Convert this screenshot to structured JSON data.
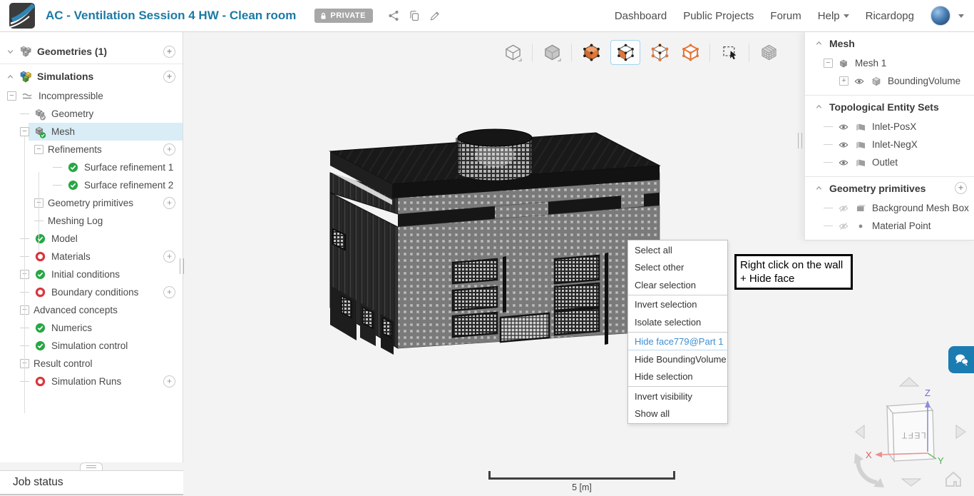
{
  "header": {
    "title": "AC - Ventilation Session 4 HW - Clean room",
    "private_badge": "PRIVATE",
    "action_icons": [
      "share-icon",
      "duplicate-icon",
      "edit-icon"
    ],
    "nav_items": [
      "Dashboard",
      "Public Projects",
      "Forum",
      "Help",
      "Ricardopg"
    ],
    "accent_blue": "#1b7aa6"
  },
  "sidebar": {
    "tree": [
      {
        "label": "Geometries (1)",
        "depth": 0,
        "icon": "geometries-icon",
        "chevron": "down",
        "plus": true,
        "divider_after": true
      },
      {
        "label": "Simulations",
        "depth": 0,
        "icon": "simulations-icon",
        "chevron": "up",
        "plus": true
      },
      {
        "label": "Incompressible",
        "depth": 1,
        "icon": "incompressible-icon",
        "expand": "minus"
      },
      {
        "label": "Geometry",
        "depth": 2,
        "icon": "geometry-icon"
      },
      {
        "label": "Mesh",
        "depth": 2,
        "icon": "mesh-icon",
        "expand": "minus",
        "selected": true
      },
      {
        "label": "Refinements",
        "depth": 3,
        "expand": "minus",
        "plus": true
      },
      {
        "label": "Surface refinement 1",
        "depth": 4,
        "status": "ok"
      },
      {
        "label": "Surface refinement 2",
        "depth": 4,
        "status": "ok"
      },
      {
        "label": "Geometry primitives",
        "depth": 3,
        "expand": "plus",
        "plus": true
      },
      {
        "label": "Meshing Log",
        "depth": 3
      },
      {
        "label": "Model",
        "depth": 2,
        "status": "ok"
      },
      {
        "label": "Materials",
        "depth": 2,
        "status": "todo",
        "plus": true
      },
      {
        "label": "Initial conditions",
        "depth": 2,
        "status": "ok",
        "expand": "plus"
      },
      {
        "label": "Boundary conditions",
        "depth": 2,
        "status": "todo",
        "plus": true
      },
      {
        "label": "Advanced concepts",
        "depth": 2,
        "expand": "plus"
      },
      {
        "label": "Numerics",
        "depth": 2,
        "status": "ok"
      },
      {
        "label": "Simulation control",
        "depth": 2,
        "status": "ok"
      },
      {
        "label": "Result control",
        "depth": 2,
        "expand": "plus"
      },
      {
        "label": "Simulation Runs",
        "depth": 2,
        "status": "todo",
        "plus": true
      }
    ],
    "job_status_label": "Job status",
    "status_ok_color": "#27a744",
    "status_todo_color": "#d9363e",
    "selected_row_color": "#d9edf6"
  },
  "viewport": {
    "toolbar_icons": [
      {
        "name": "wireframe-view-icon",
        "divider_after": true
      },
      {
        "name": "solid-view-icon",
        "divider_after": true
      },
      {
        "name": "select-volume-icon"
      },
      {
        "name": "select-face-icon",
        "active": true
      },
      {
        "name": "select-vertex-icon"
      },
      {
        "name": "select-edge-icon",
        "divider_after": true
      },
      {
        "name": "box-select-icon",
        "divider_after": true
      },
      {
        "name": "mesh-display-icon"
      }
    ],
    "scale_bar_label": "5 [m]",
    "annotation": {
      "line1": "Right click on the wall",
      "line2": "+ Hide face"
    },
    "context_menu": {
      "groups": [
        [
          "Select all",
          "Select other",
          "Clear selection"
        ],
        [
          "Invert selection",
          "Isolate selection"
        ],
        [
          "Hide face779@Part 1",
          "Hide BoundingVolume",
          "Hide selection"
        ],
        [
          "Invert visibility",
          "Show all"
        ]
      ],
      "highlighted_item": "Hide face779@Part 1",
      "highlight_color": "#3d8fd1"
    },
    "nav_cube": {
      "front_face_label": "LEFT",
      "axis_x": "X",
      "axis_y": "Y",
      "axis_z": "Z"
    },
    "chat_button_color": "#1b7cb2"
  },
  "right_panel": {
    "sections": [
      {
        "title": "Mesh",
        "rows": [
          {
            "label": "Mesh 1",
            "depth": 0,
            "expand": "minus",
            "icon": "mesh-part-icon"
          },
          {
            "label": "BoundingVolume",
            "depth": 1,
            "expand": "plus",
            "eye": "on",
            "icon": "cube-icon"
          }
        ]
      },
      {
        "title": "Topological Entity Sets",
        "rows": [
          {
            "label": "Inlet-PosX",
            "depth": 0,
            "eye": "on",
            "icon": "face-icon"
          },
          {
            "label": "Inlet-NegX",
            "depth": 0,
            "eye": "on",
            "icon": "face-icon"
          },
          {
            "label": "Outlet",
            "depth": 0,
            "eye": "on",
            "icon": "face-icon"
          }
        ]
      },
      {
        "title": "Geometry primitives",
        "plus": true,
        "rows": [
          {
            "label": "Background Mesh Box",
            "depth": 0,
            "eye": "off",
            "icon": "box-icon"
          },
          {
            "label": "Material Point",
            "depth": 0,
            "eye": "off",
            "icon": "point-icon"
          }
        ]
      }
    ]
  }
}
